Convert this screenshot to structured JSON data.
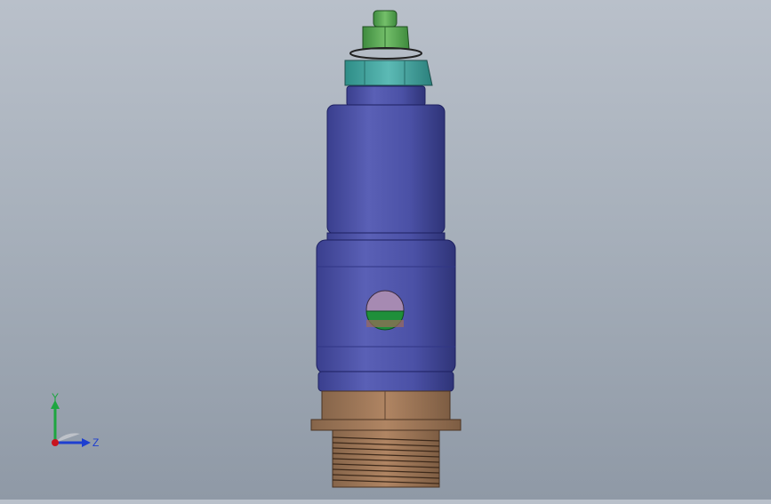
{
  "viewport": {
    "model": "valve-assembly",
    "colors": {
      "nut_green": "#5aa353",
      "nut_teal": "#3f9c9a",
      "body_blue": "#4c52a6",
      "brass": "#a47c5c",
      "port_purple": "#a68ab2",
      "port_green": "#1f8f3a"
    }
  },
  "triad": {
    "y_label": "Y",
    "z_label": "Z",
    "y_color": "#1ea640",
    "z_color": "#1e3fd0",
    "x_color": "#c8141e"
  }
}
